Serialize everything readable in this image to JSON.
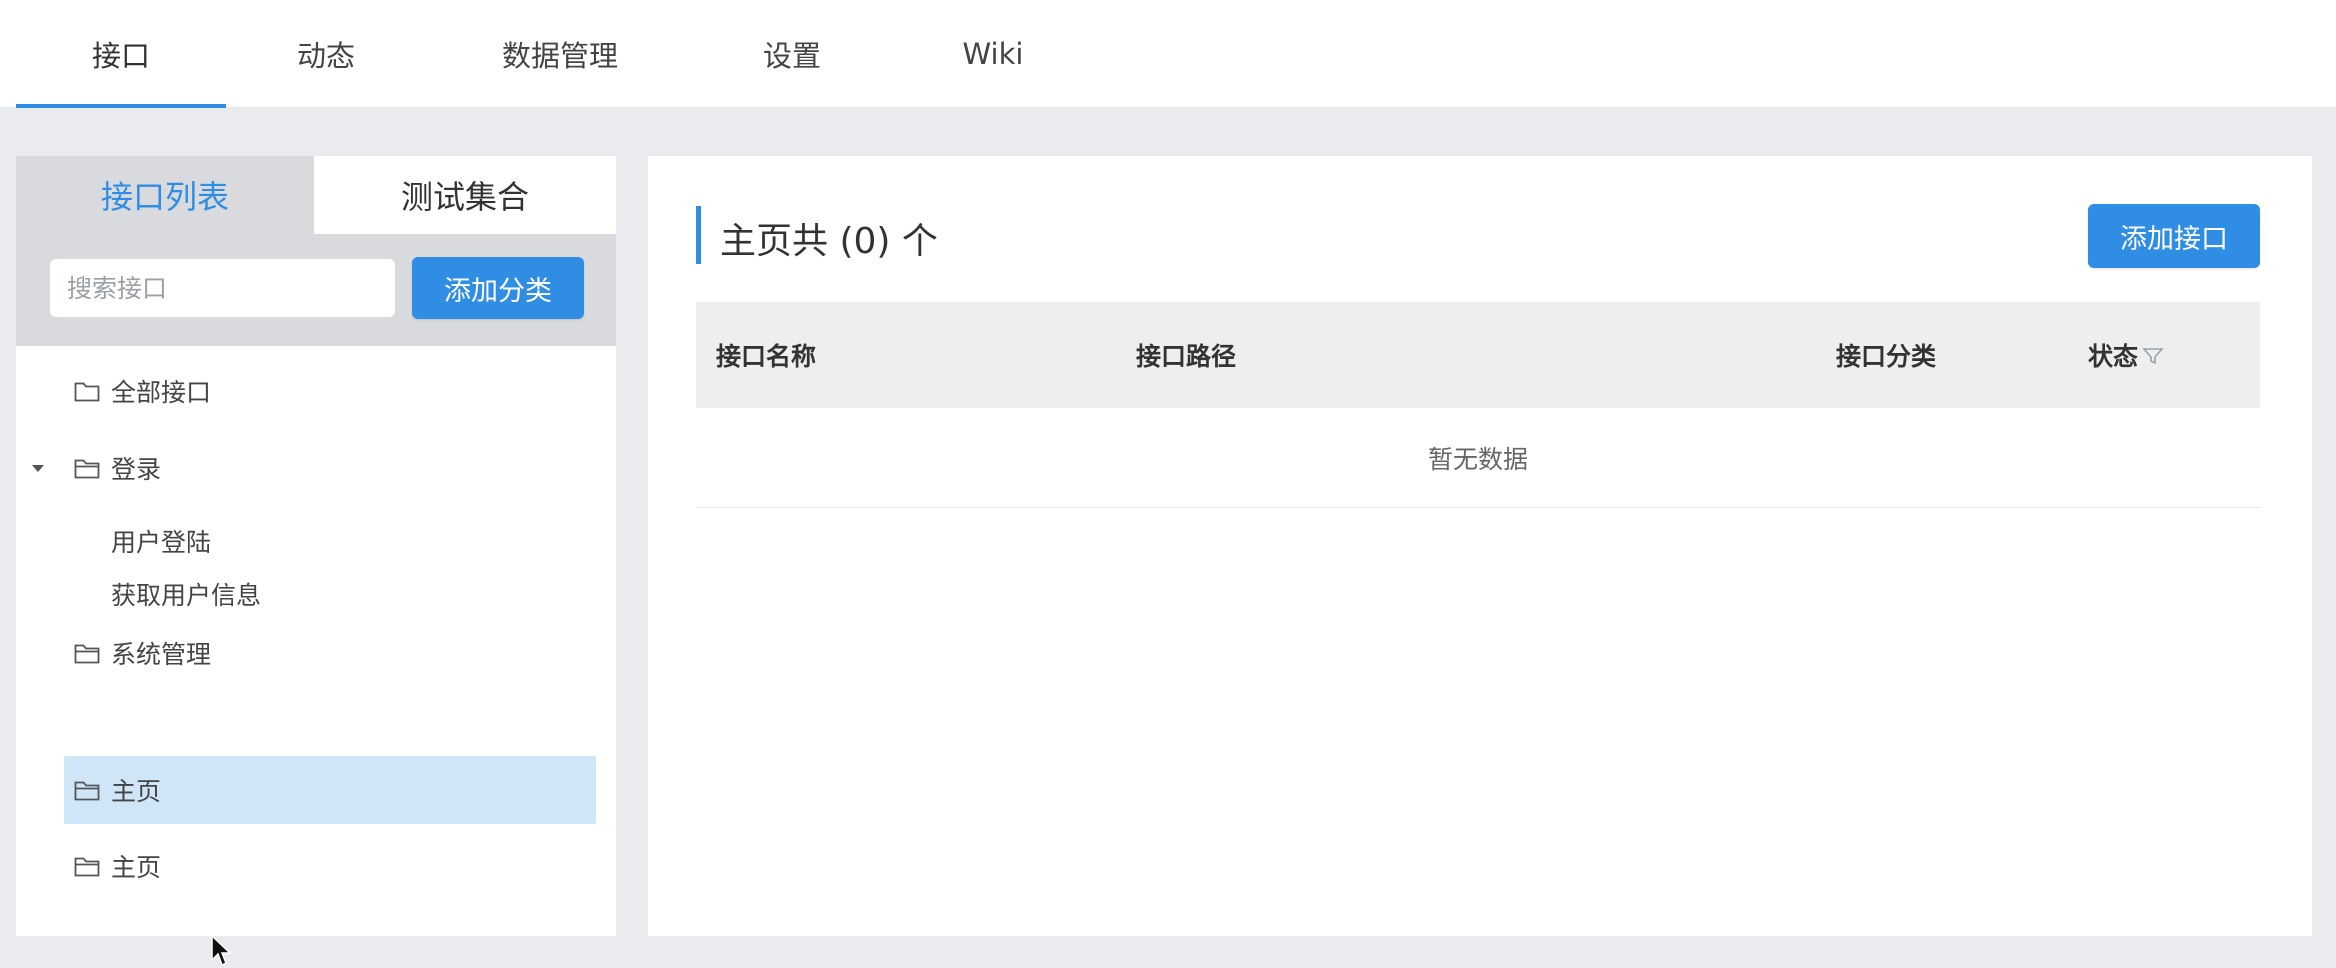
{
  "topnav": {
    "tabs": [
      {
        "label": "接口"
      },
      {
        "label": "动态"
      },
      {
        "label": "数据管理"
      },
      {
        "label": "设置"
      },
      {
        "label": "Wiki"
      }
    ]
  },
  "left": {
    "tabs": [
      {
        "label": "接口列表"
      },
      {
        "label": "测试集合"
      }
    ],
    "search": {
      "placeholder": "搜索接口",
      "value": ""
    },
    "add_category_label": "添加分类",
    "tree": [
      {
        "label": "全部接口"
      },
      {
        "label": "登录"
      },
      {
        "label": "用户登陆"
      },
      {
        "label": "获取用户信息"
      },
      {
        "label": "系统管理"
      },
      {
        "label": "主页"
      },
      {
        "label": "主页"
      }
    ]
  },
  "main": {
    "title": "主页共 (0) 个",
    "add_api_label": "添加接口",
    "columns": [
      "接口名称",
      "接口路径",
      "接口分类",
      "状态"
    ],
    "empty_text": "暂无数据"
  },
  "colors": {
    "accent": "#2f8de4",
    "selected_bg": "#cfe6f9",
    "tool_bg": "#d8dadd",
    "page_bg": "#e9ebef"
  }
}
